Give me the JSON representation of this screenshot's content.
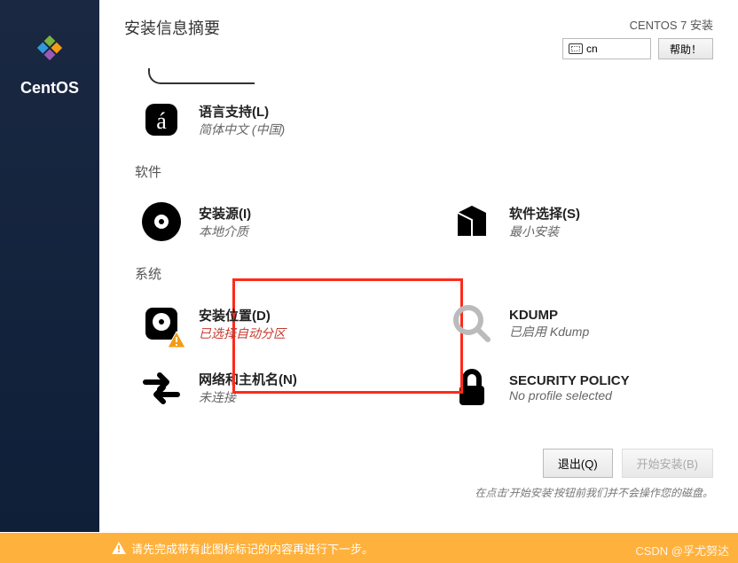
{
  "sidebar": {
    "brand": "CentOS"
  },
  "header": {
    "title": "安装信息摘要",
    "install_label": "CENTOS 7 安装",
    "lang_code": "cn",
    "help": "帮助！"
  },
  "sections": {
    "localization": {
      "lang_support": {
        "title": "语言支持(L)",
        "sub": "简体中文 (中国)"
      }
    },
    "software": {
      "header": "软件",
      "source": {
        "title": "安装源(I)",
        "sub": "本地介质"
      },
      "selection": {
        "title": "软件选择(S)",
        "sub": "最小安装"
      }
    },
    "system": {
      "header": "系统",
      "dest": {
        "title": "安装位置(D)",
        "sub": "已选择自动分区"
      },
      "kdump": {
        "title": "KDUMP",
        "sub": "已启用 Kdump"
      },
      "network": {
        "title": "网络和主机名(N)",
        "sub": "未连接"
      },
      "security": {
        "title": "SECURITY POLICY",
        "sub": "No profile selected"
      }
    }
  },
  "footer": {
    "quit": "退出(Q)",
    "begin": "开始安装(B)",
    "note": "在点击'开始安装'按钮前我们并不会操作您的磁盘。"
  },
  "warning": "请先完成带有此图标标记的内容再进行下一步。",
  "watermark": "CSDN @孚尤努达"
}
